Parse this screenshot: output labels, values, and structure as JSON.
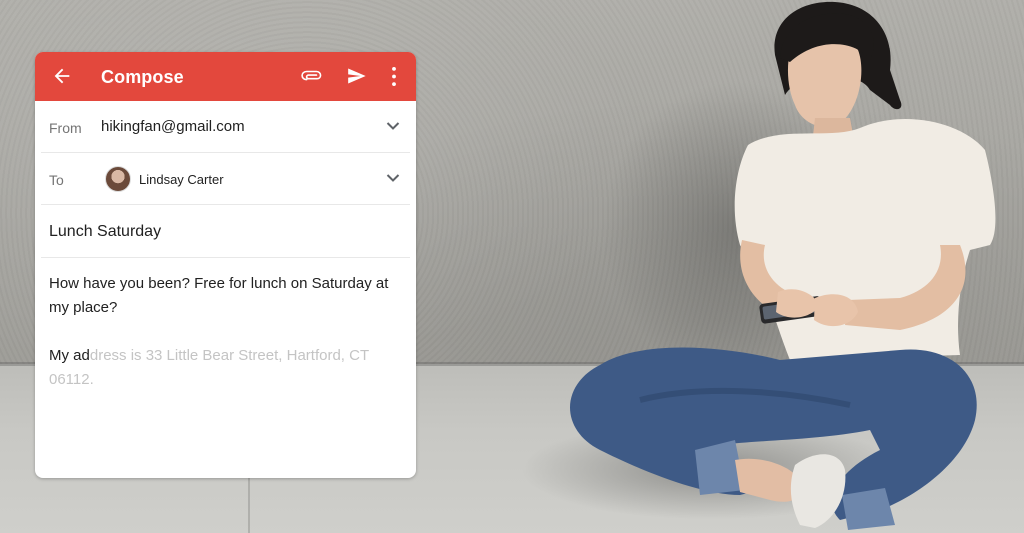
{
  "compose": {
    "title": "Compose",
    "from_label": "From",
    "from_value": "hikingfan@gmail.com",
    "to_label": "To",
    "to_recipient": "Lindsay Carter",
    "subject": "Lunch Saturday",
    "body_para1": "How have you been? Free for lunch on Saturday at my place?",
    "body_typed": "My ad",
    "body_suggestion": "dress is 33 Little Bear Street, Hartford, CT 06112.",
    "accent_color": "#e3483d"
  },
  "icons": {
    "back": "arrow-back-icon",
    "attach": "attach-icon",
    "send": "send-icon",
    "more": "more-vert-icon",
    "expand": "chevron-down-icon"
  }
}
